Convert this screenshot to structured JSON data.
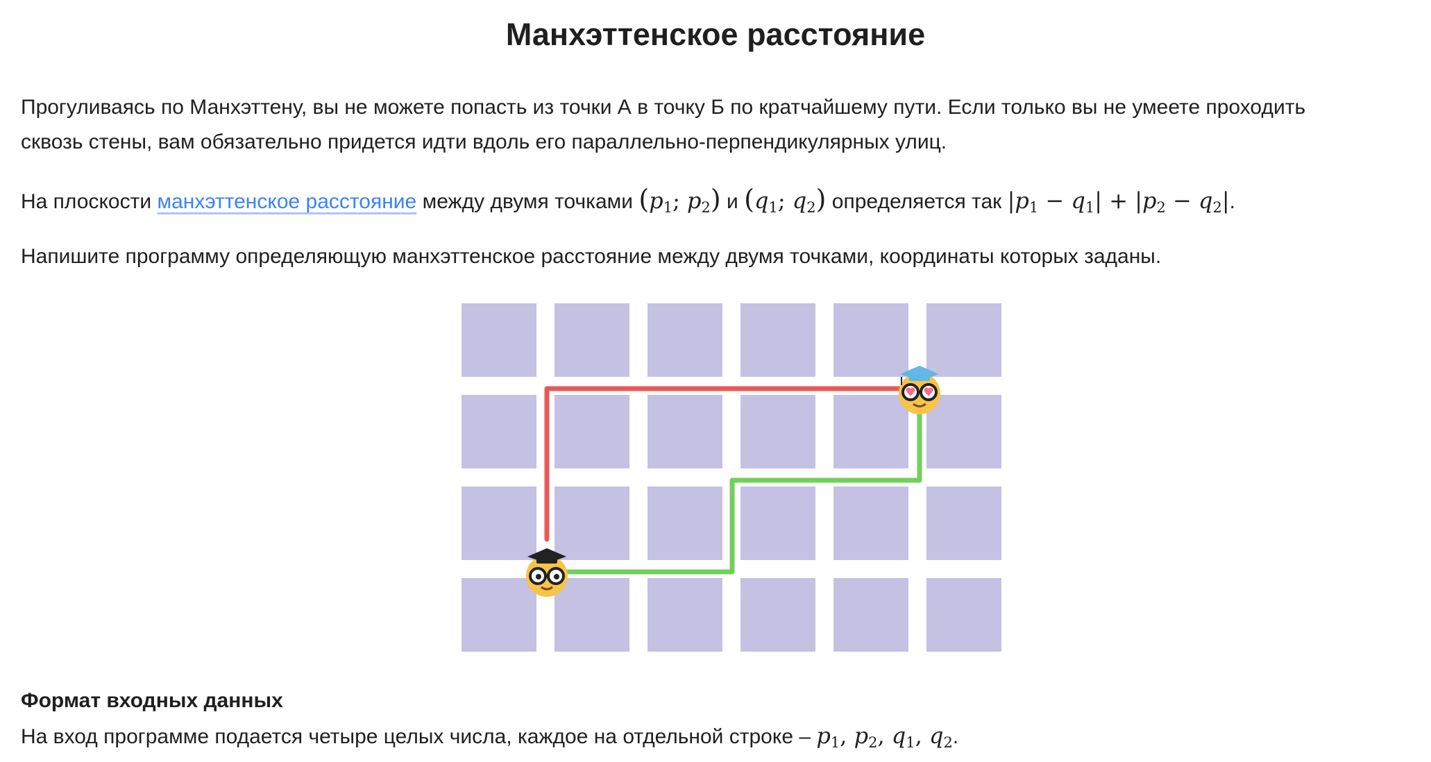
{
  "title": "Манхэттенское расстояние",
  "paragraph1": {
    "line1": "Прогуливаясь по Манхэттену, вы не можете попасть из точки А в точку Б по кратчайшему пути. Если только вы не умеете проходить",
    "line2": "сквозь стены, вам обязательно придется идти вдоль его параллельно-перпендикулярных улиц."
  },
  "paragraph2": {
    "before_link": "На плоскости ",
    "link_text": "манхэттенское расстояние",
    "after_link": " между двумя точками ",
    "and": " и ",
    "defined_as": " определяется так ",
    "end": "."
  },
  "math": {
    "p": "p",
    "q": "q",
    "sub1": "1",
    "sub2": "2",
    "sep": "; ",
    "minus": " − ",
    "plus": " + ",
    "comma": ", ",
    "bar": "|"
  },
  "paragraph3": "Напишите программу определяющую манхэттенское расстояние между двумя точками, координаты которых заданы.",
  "figure": {
    "grid_columns": 6,
    "grid_rows": 4,
    "colors": {
      "block": "#c5c1e3",
      "red_path": "#e85a57",
      "green_path": "#72d05a",
      "face": "#f7c448",
      "cap_dark": "#222222",
      "cap_blue": "#62b7e6",
      "heart": "#ff6b8a"
    },
    "start_character": "student-emoji",
    "end_character": "heart-eyes-student-emoji"
  },
  "section_input": {
    "heading": "Формат входных данных",
    "text": "На вход программе подается четыре целых числа, каждое на отдельной строке – ",
    "end": "."
  }
}
